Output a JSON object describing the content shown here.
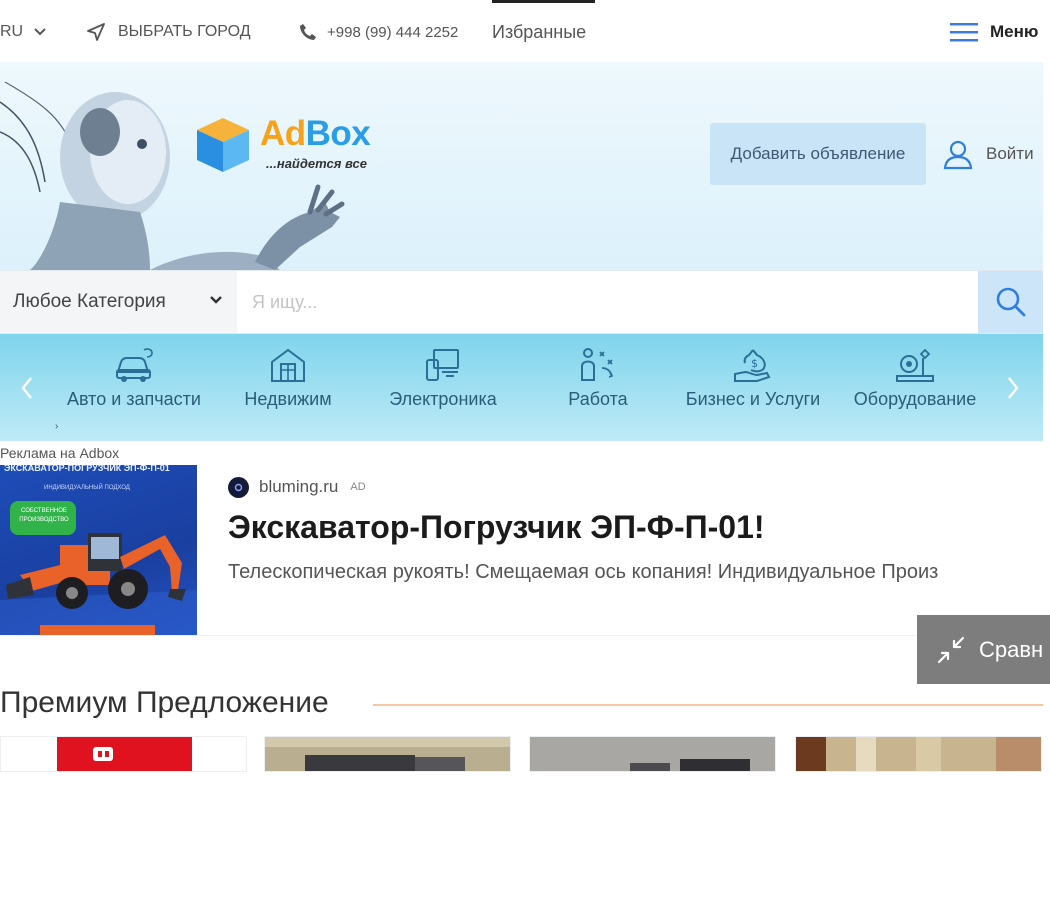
{
  "topbar": {
    "language": "RU",
    "city_label": "ВЫБРАТЬ ГОРОД",
    "phone": "+998 (99) 444 2252",
    "favorites": "Избранные",
    "menu": "Меню"
  },
  "header": {
    "logo_ad": "Ad",
    "logo_box": "Box",
    "tagline": "...найдется все",
    "add_ad_button": "Добавить объявление",
    "login": "Войти"
  },
  "search": {
    "category": "Любое Категория",
    "placeholder": "Я ищу..."
  },
  "categories": [
    {
      "label": "Авто и запчасти",
      "icon": "car-icon"
    },
    {
      "label": "Недвижим",
      "icon": "house-icon"
    },
    {
      "label": "Электроника",
      "icon": "devices-icon"
    },
    {
      "label": "Работа",
      "icon": "work-icon"
    },
    {
      "label": "Бизнес и Услуги",
      "icon": "money-bag-icon"
    },
    {
      "label": "Оборудование",
      "icon": "equipment-icon"
    }
  ],
  "ad": {
    "label": "Реклама на Adbox",
    "image_header": "ЭКСКАВАТОР-ПОГРУЗЧИК ЭП-Ф-П-01",
    "image_subheader": "ИНДИВИДУАЛЬНЫЙ ПОДХОД",
    "image_bubble": "СОБСТВЕННОЕ ПРОИЗВОДСТВО",
    "site": "bluming.ru",
    "tag": "AD",
    "title": "Экскаватор-Погрузчик ЭП-Ф-П-01!",
    "description": "Телескопическая рукоять! Смещаемая ось копания! Индивидуальное Произ"
  },
  "compare": {
    "label": "Сравн"
  },
  "premium": {
    "title": "Премиум Предложение"
  },
  "colors": {
    "brand_orange": "#f7a21b",
    "brand_blue": "#2a9de6",
    "category_bar": "#7fd4ec",
    "accent_line": "#f6c6a3"
  }
}
